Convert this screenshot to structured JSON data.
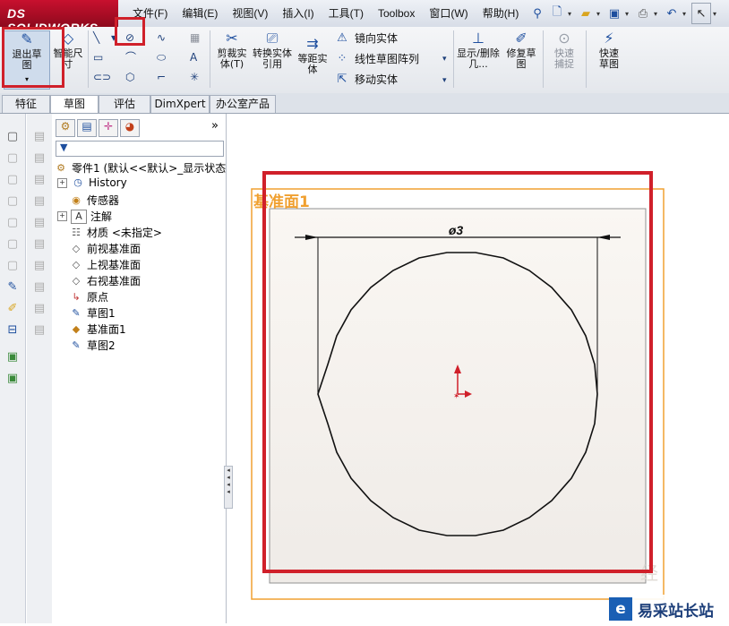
{
  "app": {
    "logo_text": "DS SOLIDWORKS"
  },
  "menu": [
    "文件(F)",
    "编辑(E)",
    "视图(V)",
    "插入(I)",
    "工具(T)",
    "Toolbox",
    "窗口(W)",
    "帮助(H)"
  ],
  "quick_access": [
    "pin-icon",
    "new-icon",
    "open-icon",
    "save-icon",
    "print-icon",
    "undo-icon",
    "select-icon"
  ],
  "ribbon": {
    "exit_sketch": "退出草图",
    "smart_dim": "智能尺寸",
    "trim": "剪裁实体(T)",
    "convert": "转换实体引用",
    "offset": "等距实体",
    "mirror": "镜向实体",
    "linear_pattern": "线性草图阵列",
    "move": "移动实体",
    "show_delete": "显示/删除几...",
    "repair": "修复草图",
    "quick_snap": "快速捕捉",
    "rapid_sketch": "快速草图"
  },
  "tabs": [
    "特征",
    "草图",
    "评估",
    "DimXpert",
    "办公室产品"
  ],
  "active_tab": "草图",
  "tree": {
    "root": "零件1 (默认<<默认>_显示状态",
    "items": [
      "History",
      "传感器",
      "注解",
      "材质 <未指定>",
      "前视基准面",
      "上视基准面",
      "右视基准面",
      "原点",
      "草图1",
      "基准面1",
      "草图2"
    ]
  },
  "graphics": {
    "plane_label": "基准面1",
    "dimension": "ø3",
    "plane_color": "#f0a030",
    "highlight_color": "#d0202a",
    "diameter_value": 3
  },
  "watermark": {
    "text": "易采站长站",
    "logo_char": "e",
    "faint_char": "经"
  }
}
